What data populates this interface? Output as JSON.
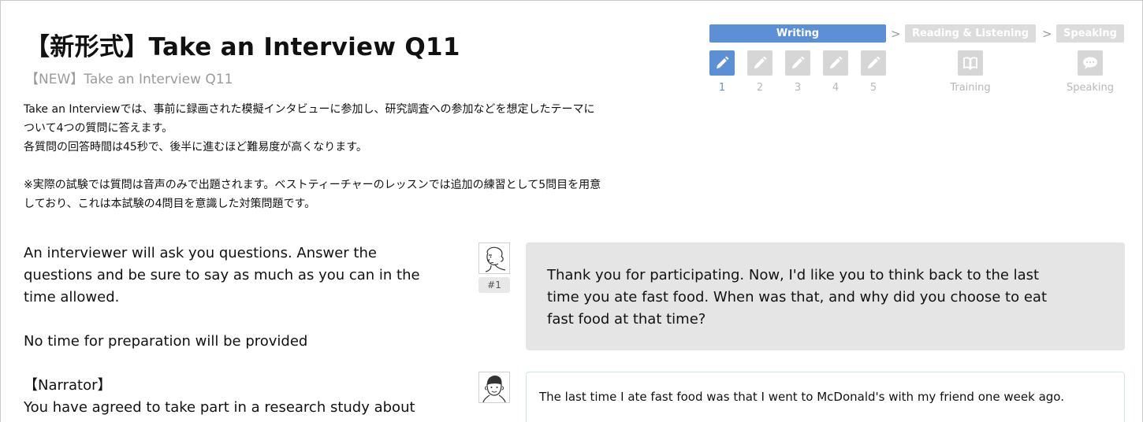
{
  "header": {
    "title": "【新形式】Take an Interview Q11",
    "subtitle": "【NEW】Take an Interview Q11"
  },
  "description": {
    "lines": [
      "Take an Interviewでは、事前に録画された模擬インタビューに参加し、研究調査への参加などを想定したテーマに",
      "ついて4つの質問に答えます。",
      "各質問の回答時間は45秒で、後半に進むほど難易度が高くなります。",
      "",
      "※実際の試験では質問は音声のみで出題されます。ベストティーチャーのレッスンでは追加の練習として5問目を用意",
      "しており、これは本試験の4問目を意識した対策問題です。"
    ]
  },
  "progress": {
    "stages": [
      {
        "label": "Writing",
        "state": "active"
      },
      {
        "label": "Reading & Listening",
        "state": "inactive"
      },
      {
        "label": "Speaking",
        "state": "inactive"
      }
    ],
    "steps": [
      {
        "label": "1",
        "icon": "pencil-icon",
        "state": "active"
      },
      {
        "label": "2",
        "icon": "pencil-icon",
        "state": "inactive"
      },
      {
        "label": "3",
        "icon": "pencil-icon",
        "state": "inactive"
      },
      {
        "label": "4",
        "icon": "pencil-icon",
        "state": "inactive"
      },
      {
        "label": "5",
        "icon": "pencil-icon",
        "state": "inactive"
      },
      {
        "label": "Training",
        "icon": "book-icon",
        "state": "inactive"
      },
      {
        "label": "Speaking",
        "icon": "speech-bubble-icon",
        "state": "inactive"
      }
    ],
    "chevron": ">",
    "colors": {
      "active": "#5b8fd6",
      "inactive": "#dcdcdc"
    }
  },
  "instructions": {
    "lines": [
      "An interviewer will ask you questions. Answer the",
      "questions and be sure to say as much as you can in the",
      "time allowed.",
      "",
      "No time for preparation will be provided",
      "",
      " 【Narrator】",
      "You have agreed to take part in a research study about"
    ]
  },
  "chat": {
    "question": {
      "badge": "#1",
      "avatar_icon": "interviewer-avatar-icon",
      "lines": [
        "Thank you for participating. Now, I'd like you to think back to the last",
        "time you ate fast food. When was that, and why did you choose to eat",
        "fast food at that time?"
      ]
    },
    "answer": {
      "avatar_icon": "student-avatar-icon",
      "text": "The last time I ate fast food was that I went to McDonald's with my friend one week ago."
    }
  }
}
